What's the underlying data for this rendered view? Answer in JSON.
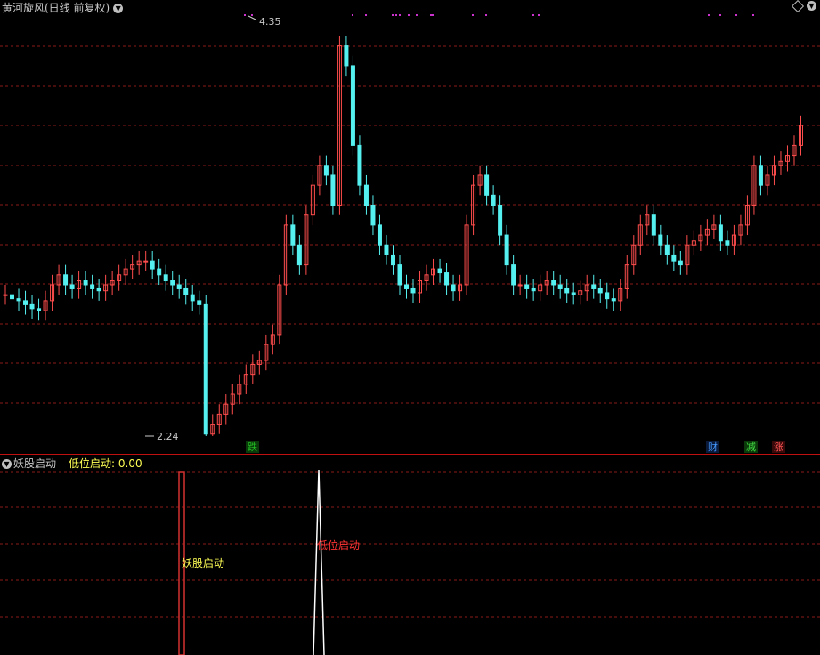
{
  "main": {
    "title": "黄河旋风(日线 前复权)",
    "high_label": "4.35",
    "low_label": "2.24",
    "badges": [
      {
        "text": "跌",
        "color": "#22bb22",
        "bg": "#0a3a0a"
      },
      {
        "text": "财",
        "color": "#4499ff",
        "bg": "#0a1a3a"
      },
      {
        "text": "减",
        "color": "#44dd44",
        "bg": "#0a3a0a"
      },
      {
        "text": "涨",
        "color": "#ff5555",
        "bg": "#3a0a0a"
      }
    ]
  },
  "sub": {
    "name": "妖股启动",
    "indicator_label": "低位启动: 0.00",
    "bar_label_yao": "妖股启动",
    "bar_label_low": "低位启动"
  },
  "colors": {
    "up": "#ff4d4d",
    "down": "#55f0f0",
    "grid": "#8b1a1a",
    "marker": "#cc33cc"
  },
  "chart_data": {
    "type": "candlestick",
    "y_high": 4.35,
    "y_low": 2.24,
    "series": [
      {
        "name": "price",
        "values": [
          2.95,
          2.93,
          2.92,
          2.9,
          2.88,
          2.87,
          2.92,
          3.0,
          3.05,
          3.0,
          2.98,
          3.02,
          3.0,
          2.98,
          2.97,
          3.0,
          3.02,
          3.05,
          3.08,
          3.1,
          3.12,
          3.12,
          3.08,
          3.05,
          3.02,
          3.0,
          2.98,
          2.95,
          2.92,
          2.9,
          2.25,
          2.3,
          2.35,
          2.4,
          2.45,
          2.5,
          2.55,
          2.6,
          2.62,
          2.7,
          2.75,
          3.0,
          3.3,
          3.2,
          3.1,
          3.35,
          3.5,
          3.6,
          3.55,
          3.4,
          4.2,
          4.1,
          3.7,
          3.5,
          3.4,
          3.3,
          3.2,
          3.15,
          3.1,
          3.0,
          2.98,
          2.96,
          3.02,
          3.05,
          3.08,
          3.06,
          3.0,
          2.97,
          3.0,
          3.3,
          3.5,
          3.55,
          3.45,
          3.4,
          3.25,
          3.1,
          3.0,
          3.0,
          2.98,
          2.97,
          3.0,
          3.02,
          3.0,
          2.98,
          2.96,
          2.95,
          2.97,
          3.0,
          2.98,
          2.96,
          2.93,
          2.92,
          2.98,
          3.1,
          3.2,
          3.3,
          3.35,
          3.25,
          3.2,
          3.15,
          3.12,
          3.1,
          3.2,
          3.22,
          3.25,
          3.28,
          3.3,
          3.22,
          3.2,
          3.25,
          3.3,
          3.4,
          3.6,
          3.5,
          3.55,
          3.6,
          3.62,
          3.65,
          3.7,
          3.8
        ]
      }
    ]
  }
}
